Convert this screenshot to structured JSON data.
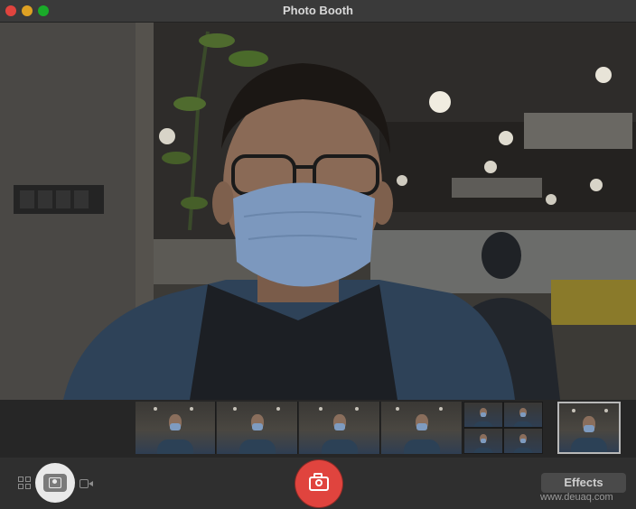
{
  "window": {
    "title": "Photo Booth"
  },
  "toolbar": {
    "effects_label": "Effects"
  },
  "watermark": "www.deuaq.com",
  "icons": {
    "grid_mode": "four-up-grid-icon",
    "single_mode": "single-photo-icon",
    "video_mode": "video-camera-icon",
    "shutter": "camera-icon"
  },
  "colors": {
    "shutter": "#e0443e",
    "close": "#e0443e",
    "minimize": "#dea123",
    "maximize": "#1aab29"
  }
}
